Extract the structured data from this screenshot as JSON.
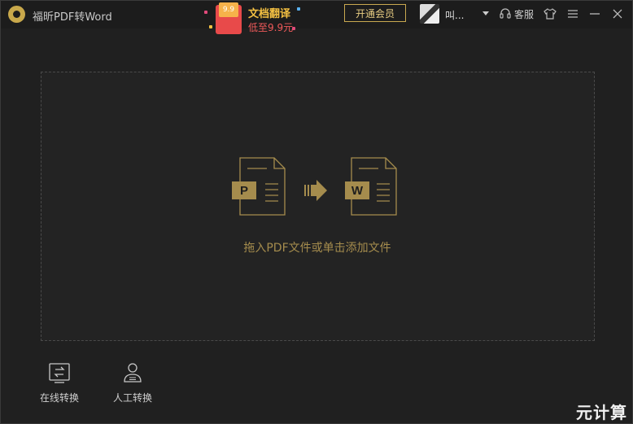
{
  "app": {
    "title": "福昕PDF转Word"
  },
  "promo": {
    "badge": "9.9",
    "line1": "文档翻译",
    "line2": "低至9.9元"
  },
  "header": {
    "vip_button": "开通会员",
    "username": "叫...",
    "support_label": "客服"
  },
  "drop_zone": {
    "source_letter": "P",
    "target_letter": "W",
    "hint": "拖入PDF文件或单击添加文件"
  },
  "tools": [
    {
      "label": "在线转换",
      "icon": "online-convert-icon"
    },
    {
      "label": "人工转换",
      "icon": "manual-convert-icon"
    }
  ],
  "watermark": "元计算",
  "colors": {
    "accent": "#c9a850",
    "hint": "#a58c4d",
    "background": "#202020"
  }
}
